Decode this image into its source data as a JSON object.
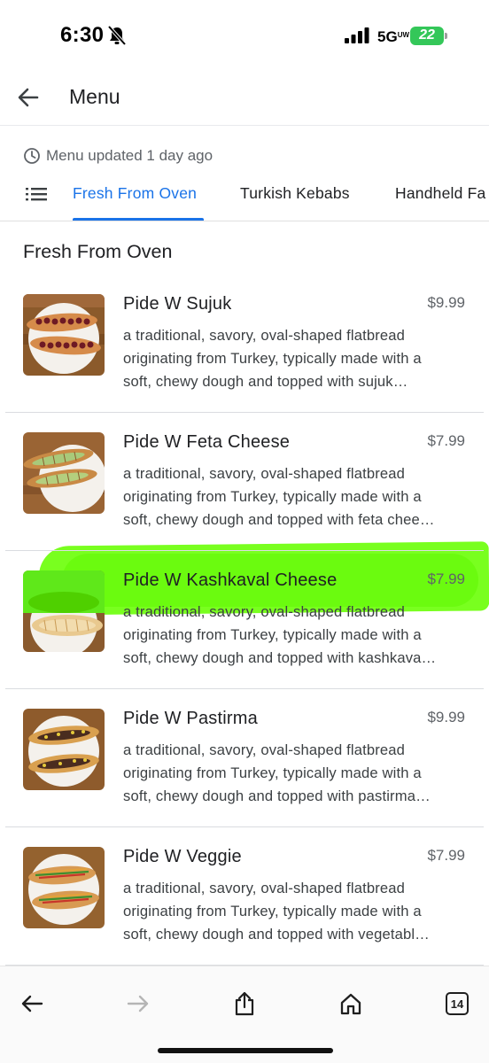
{
  "status_bar": {
    "time": "6:30",
    "network": "5G",
    "network_suffix": "UW",
    "battery": "22"
  },
  "app_bar": {
    "title": "Menu",
    "back_icon": "arrow-back-icon"
  },
  "updated": {
    "text": "Menu updated 1 day ago",
    "icon": "clock-icon"
  },
  "tabs": [
    {
      "label": "Fresh From Oven",
      "active": true
    },
    {
      "label": "Turkish Kebabs",
      "active": false
    },
    {
      "label": "Handheld Fa",
      "active": false
    }
  ],
  "section": {
    "title": "Fresh From Oven"
  },
  "items": [
    {
      "name": "Pide W Sujuk",
      "price": "$9.99",
      "desc": [
        "a traditional, savory, oval-shaped flatbread",
        "originating from Turkey, typically made with a",
        "soft, chewy dough and topped with sujuk…"
      ]
    },
    {
      "name": "Pide W Feta Cheese",
      "price": "$7.99",
      "desc": [
        "a traditional, savory, oval-shaped flatbread",
        "originating from Turkey, typically made with a",
        "soft, chewy dough and topped with feta chee…"
      ]
    },
    {
      "name": "Pide W Kashkaval Cheese",
      "price": "$7.99",
      "desc": [
        "a traditional, savory, oval-shaped flatbread",
        "originating from Turkey, typically made with a",
        "soft, chewy dough and topped with kashkava…"
      ]
    },
    {
      "name": "Pide W Pastirma",
      "price": "$9.99",
      "desc": [
        "a traditional, savory, oval-shaped flatbread",
        "originating from Turkey, typically made with a",
        "soft, chewy dough and topped with pastirma…"
      ]
    },
    {
      "name": "Pide W Veggie",
      "price": "$7.99",
      "desc": [
        "a traditional, savory, oval-shaped flatbread",
        "originating from Turkey, typically made with a",
        "soft, chewy dough and topped with vegetabl…"
      ]
    }
  ],
  "toolbar": {
    "tab_count": "14",
    "icons": [
      "back-arrow-icon",
      "forward-arrow-icon",
      "share-icon",
      "home-icon",
      "tabs-icon"
    ]
  },
  "colors": {
    "accent": "#1a73e8",
    "highlight": "#66ff00",
    "battery": "#34c759"
  }
}
